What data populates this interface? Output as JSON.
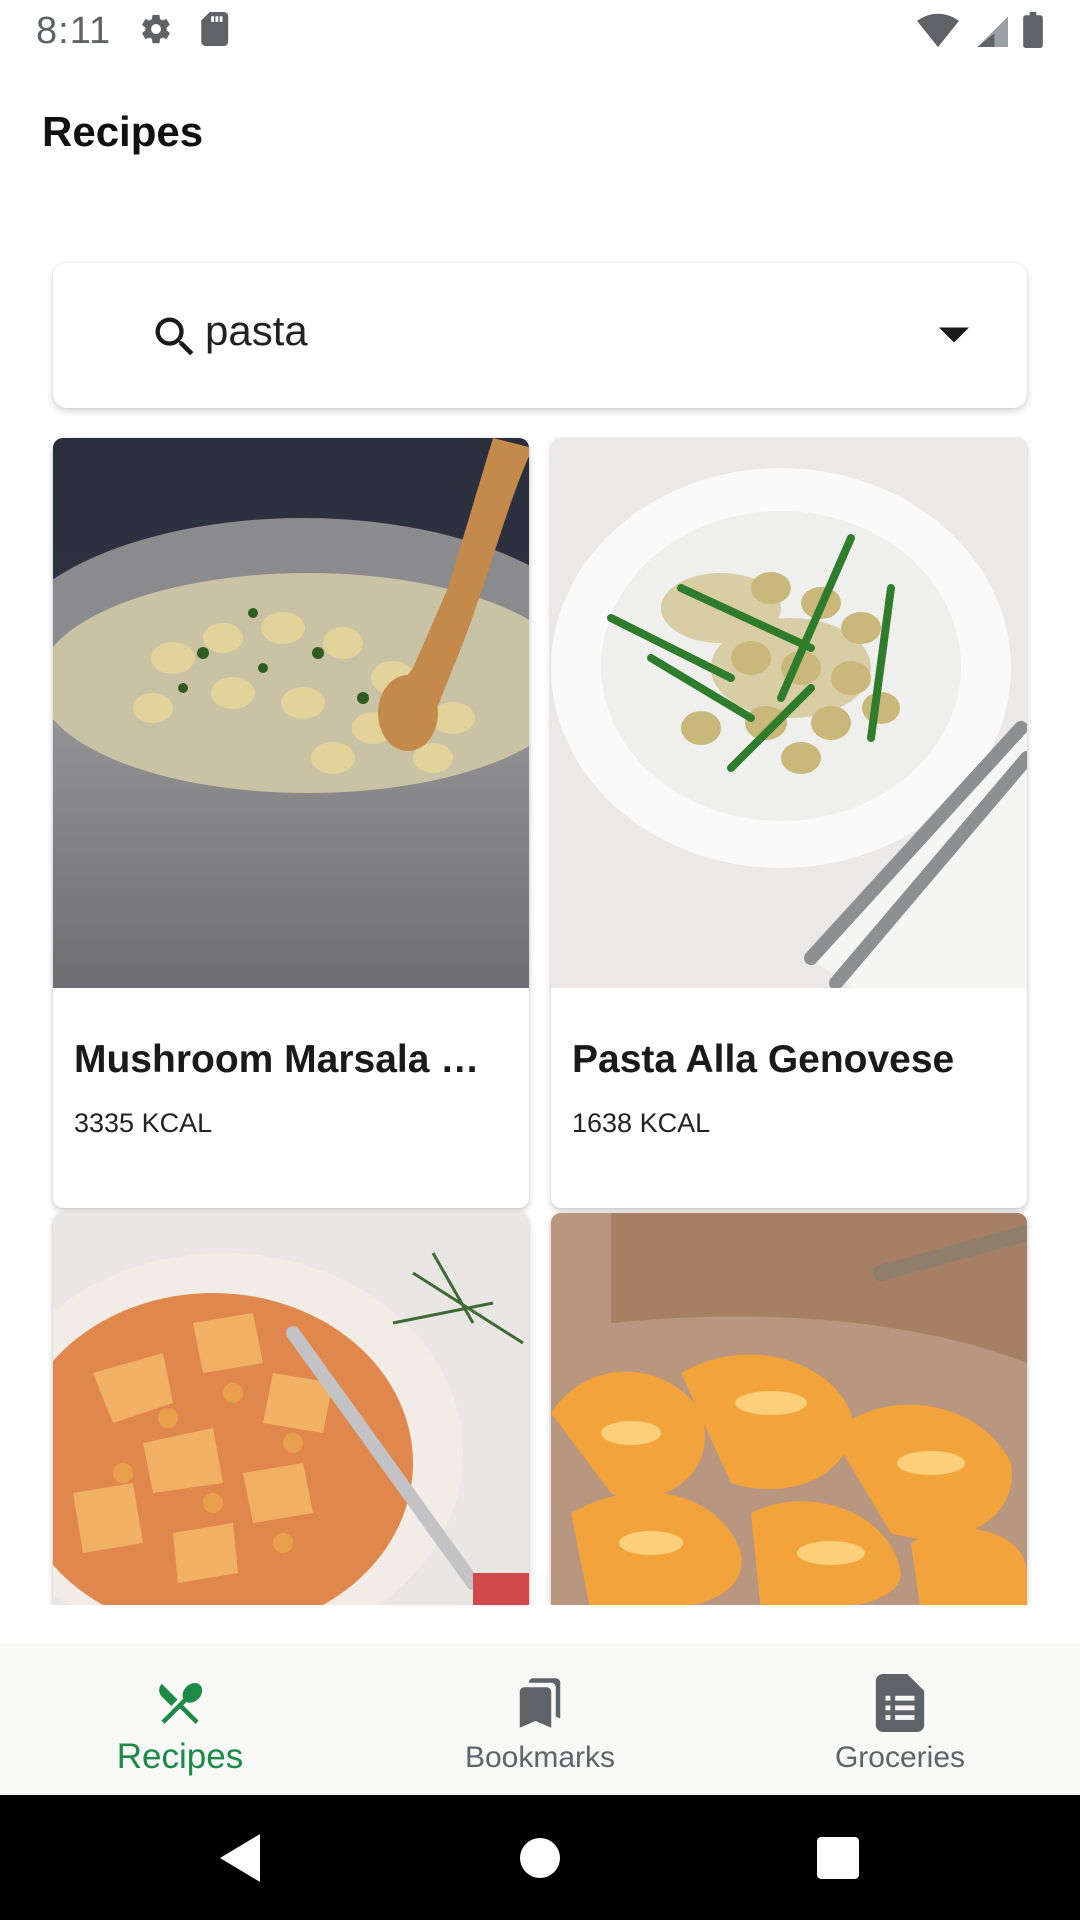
{
  "status_bar": {
    "time": "8:11",
    "icons": [
      "gear-icon",
      "sd-card-icon",
      "wifi-icon",
      "signal-icon",
      "battery-icon"
    ]
  },
  "app_bar": {
    "title": "Recipes"
  },
  "search": {
    "value": "pasta",
    "icon": "search-icon",
    "dropdown_icon": "caret-down-icon"
  },
  "recipes": [
    {
      "title": "Mushroom Marsala …",
      "kcal": "3335 KCAL"
    },
    {
      "title": "Pasta Alla Genovese",
      "kcal": "1638 KCAL"
    },
    {
      "title": "",
      "kcal": ""
    },
    {
      "title": "",
      "kcal": ""
    }
  ],
  "bottom_nav": {
    "items": [
      {
        "label": "Recipes",
        "icon": "fork-knife-icon",
        "active": true
      },
      {
        "label": "Bookmarks",
        "icon": "bookmarks-icon",
        "active": false
      },
      {
        "label": "Groceries",
        "icon": "list-document-icon",
        "active": false
      }
    ]
  },
  "system_nav": [
    "back-icon",
    "home-icon",
    "recents-icon"
  ],
  "colors": {
    "accent": "#1e8a47",
    "inactive": "#5f6368",
    "nav_background": "#f8f8f7",
    "system_nav_background": "#000000"
  }
}
